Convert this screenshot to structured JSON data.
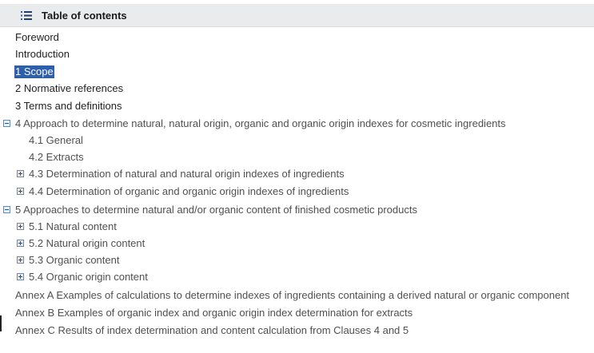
{
  "header": {
    "title": "Table of contents",
    "icon": "list-icon"
  },
  "toc": {
    "items": [
      {
        "label": "Foreword",
        "level": 0,
        "toggle": "none",
        "selected": false
      },
      {
        "label": "Introduction",
        "level": 0,
        "toggle": "none",
        "selected": false
      },
      {
        "label": "1 Scope",
        "level": 0,
        "toggle": "none",
        "selected": true
      },
      {
        "label": "2 Normative references",
        "level": 0,
        "toggle": "none",
        "selected": false
      },
      {
        "label": "3 Terms and definitions",
        "level": 0,
        "toggle": "none",
        "selected": false
      },
      {
        "label": "4 Approach to determine natural, natural origin, organic and organic origin indexes for cosmetic ingredients",
        "level": 0,
        "toggle": "collapse",
        "selected": false
      },
      {
        "label": "4.1 General",
        "level": 1,
        "toggle": "none",
        "selected": false
      },
      {
        "label": "4.2 Extracts",
        "level": 1,
        "toggle": "none",
        "selected": false
      },
      {
        "label": "4.3 Determination of natural and natural origin indexes of ingredients",
        "level": 1,
        "toggle": "expand",
        "selected": false
      },
      {
        "label": "4.4 Determination of organic and organic origin indexes of ingredients",
        "level": 1,
        "toggle": "expand",
        "selected": false
      },
      {
        "label": "5 Approaches to determine natural and/or organic content of finished cosmetic products",
        "level": 0,
        "toggle": "collapse",
        "selected": false
      },
      {
        "label": "5.1 Natural content",
        "level": 1,
        "toggle": "expand",
        "selected": false
      },
      {
        "label": "5.2 Natural origin content",
        "level": 1,
        "toggle": "expand",
        "selected": false
      },
      {
        "label": "5.3 Organic content",
        "level": 1,
        "toggle": "expand",
        "selected": false
      },
      {
        "label": "5.4 Organic origin content",
        "level": 1,
        "toggle": "expand",
        "selected": false
      },
      {
        "label": "Annex A Examples of calculations to determine indexes of ingredients containing a derived natural or organic component",
        "level": 0,
        "toggle": "none",
        "selected": false
      },
      {
        "label": "Annex B Examples of organic index and organic origin index determination for extracts",
        "level": 0,
        "toggle": "none",
        "selected": false
      },
      {
        "label": "Annex C Results of index determination and content calculation from Clauses 4 and 5",
        "level": 0,
        "toggle": "none",
        "selected": false
      }
    ]
  },
  "colors": {
    "header_bg": "#e9ebed",
    "selection_bg": "#2f5fa8",
    "icon_blue": "#2f4f78"
  }
}
